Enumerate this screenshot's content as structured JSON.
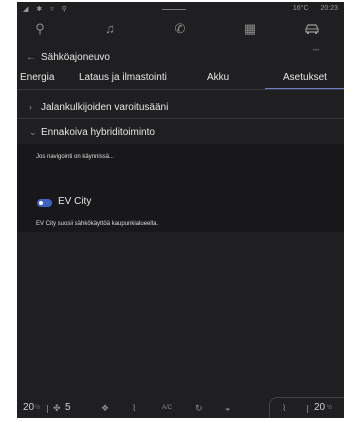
{
  "status": {
    "left_icons": "◢ ✱ ▿ ⚲",
    "temperature": "16°C",
    "time": "20:23"
  },
  "topnav": {
    "items": [
      {
        "icon": "navigation-pin-icon"
      },
      {
        "icon": "music-icon"
      },
      {
        "icon": "phone-icon"
      },
      {
        "icon": "apps-grid-icon"
      },
      {
        "icon": "car-icon",
        "active": true
      }
    ]
  },
  "page": {
    "back_icon": "arrow-left-icon",
    "title": "Sähköajoneuvo"
  },
  "tabs": [
    {
      "label": "Energia"
    },
    {
      "label": "Lataus ja ilmastointi"
    },
    {
      "label": "Akku"
    },
    {
      "label": "Asetukset",
      "selected": true
    }
  ],
  "rows": [
    {
      "label": "Jalankulkijoiden varoitusääni",
      "expanded": false
    },
    {
      "label": "Ennakoiva hybriditoiminto",
      "expanded": true
    }
  ],
  "panel": {
    "subtitle": "Jos navigointi on käynnissä...",
    "option_label": "EV City",
    "option_enabled": true,
    "option_description": "EV City suosii sähkökäyttöä kaupunkialueella."
  },
  "bottombar": {
    "left_temp": "20",
    "left_temp_unit": "½",
    "fan_speed": "5",
    "ac_label": "A/C",
    "right_temp": "20",
    "right_temp_unit": "½"
  }
}
